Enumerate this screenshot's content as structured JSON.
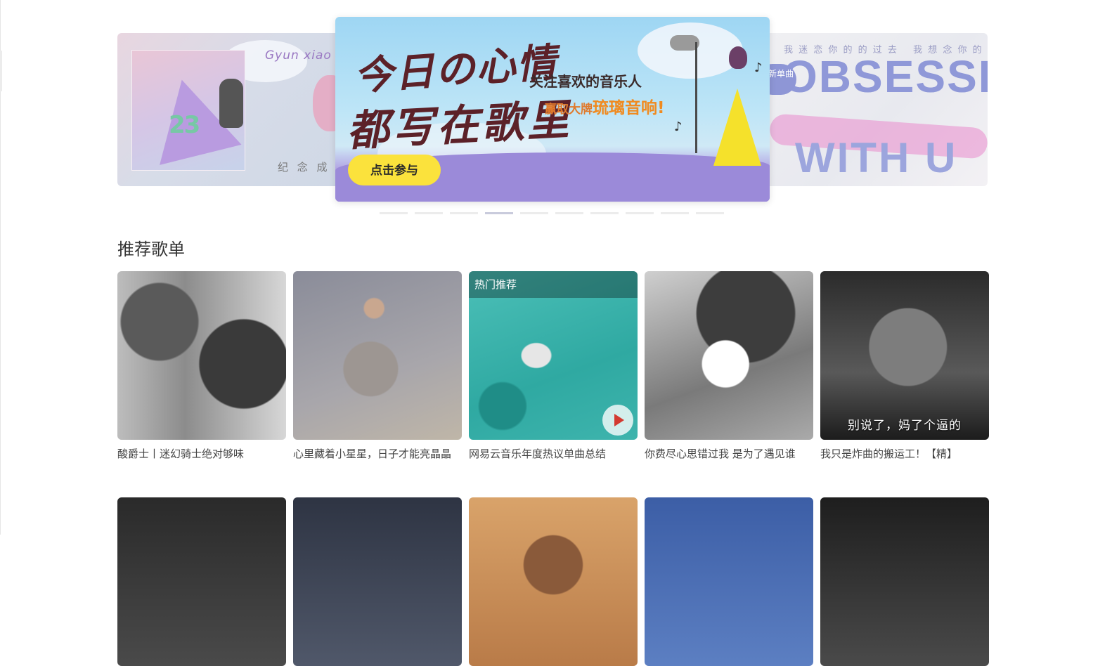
{
  "carousel": {
    "left_banner": {
      "script_text": "Gyun xiao",
      "number": "23",
      "caption": "纪 念 成"
    },
    "center_banner": {
      "title_line1": "今日の心情",
      "title_line2": "都写在歌里",
      "subtitle1": "关注喜欢的音乐人",
      "subtitle2_prefix": "赢取大牌",
      "subtitle2_emphasis": "琉璃音响!",
      "cta_label": "点击参与"
    },
    "right_banner": {
      "top_line": "我 迷 恋 你 的 的 过 去　 我 想 念 你 的 未 来",
      "big_text_line1": "OBSESSED",
      "big_text_line2": "WITH U",
      "badge": "全新单曲"
    },
    "indicator_count": 10,
    "active_index": 3
  },
  "section": {
    "title": "推荐歌单"
  },
  "playlists": [
    {
      "title": "酸爵士丨迷幻骑士绝对够味"
    },
    {
      "title": "心里藏着小星星，日子才能亮晶晶"
    },
    {
      "title": "网易云音乐年度热议单曲总结",
      "tag": "热门推荐"
    },
    {
      "title": "你费尽心思错过我 是为了遇见谁"
    },
    {
      "title": "我只是炸曲的搬运工！【精】",
      "overlay": "别说了，妈了个逼的"
    }
  ],
  "icons": {
    "play": "play-icon"
  },
  "colors": {
    "cta_yellow": "#fbe23c",
    "play_red": "#d33a31"
  }
}
